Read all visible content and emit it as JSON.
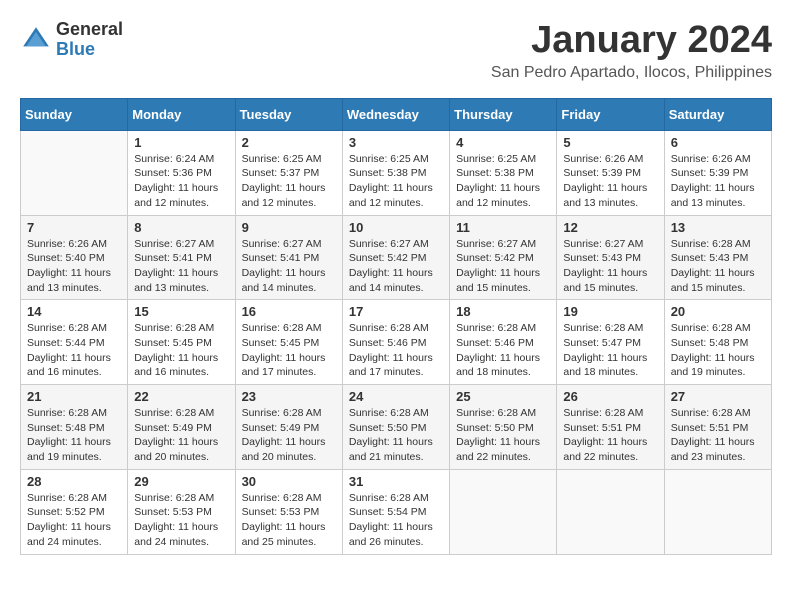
{
  "logo": {
    "general": "General",
    "blue": "Blue"
  },
  "title": "January 2024",
  "subtitle": "San Pedro Apartado, Ilocos, Philippines",
  "days_of_week": [
    "Sunday",
    "Monday",
    "Tuesday",
    "Wednesday",
    "Thursday",
    "Friday",
    "Saturday"
  ],
  "weeks": [
    [
      {
        "day": "",
        "sunrise": "",
        "sunset": "",
        "daylight": ""
      },
      {
        "day": "1",
        "sunrise": "Sunrise: 6:24 AM",
        "sunset": "Sunset: 5:36 PM",
        "daylight": "Daylight: 11 hours and 12 minutes."
      },
      {
        "day": "2",
        "sunrise": "Sunrise: 6:25 AM",
        "sunset": "Sunset: 5:37 PM",
        "daylight": "Daylight: 11 hours and 12 minutes."
      },
      {
        "day": "3",
        "sunrise": "Sunrise: 6:25 AM",
        "sunset": "Sunset: 5:38 PM",
        "daylight": "Daylight: 11 hours and 12 minutes."
      },
      {
        "day": "4",
        "sunrise": "Sunrise: 6:25 AM",
        "sunset": "Sunset: 5:38 PM",
        "daylight": "Daylight: 11 hours and 12 minutes."
      },
      {
        "day": "5",
        "sunrise": "Sunrise: 6:26 AM",
        "sunset": "Sunset: 5:39 PM",
        "daylight": "Daylight: 11 hours and 13 minutes."
      },
      {
        "day": "6",
        "sunrise": "Sunrise: 6:26 AM",
        "sunset": "Sunset: 5:39 PM",
        "daylight": "Daylight: 11 hours and 13 minutes."
      }
    ],
    [
      {
        "day": "7",
        "sunrise": "Sunrise: 6:26 AM",
        "sunset": "Sunset: 5:40 PM",
        "daylight": "Daylight: 11 hours and 13 minutes."
      },
      {
        "day": "8",
        "sunrise": "Sunrise: 6:27 AM",
        "sunset": "Sunset: 5:41 PM",
        "daylight": "Daylight: 11 hours and 13 minutes."
      },
      {
        "day": "9",
        "sunrise": "Sunrise: 6:27 AM",
        "sunset": "Sunset: 5:41 PM",
        "daylight": "Daylight: 11 hours and 14 minutes."
      },
      {
        "day": "10",
        "sunrise": "Sunrise: 6:27 AM",
        "sunset": "Sunset: 5:42 PM",
        "daylight": "Daylight: 11 hours and 14 minutes."
      },
      {
        "day": "11",
        "sunrise": "Sunrise: 6:27 AM",
        "sunset": "Sunset: 5:42 PM",
        "daylight": "Daylight: 11 hours and 15 minutes."
      },
      {
        "day": "12",
        "sunrise": "Sunrise: 6:27 AM",
        "sunset": "Sunset: 5:43 PM",
        "daylight": "Daylight: 11 hours and 15 minutes."
      },
      {
        "day": "13",
        "sunrise": "Sunrise: 6:28 AM",
        "sunset": "Sunset: 5:43 PM",
        "daylight": "Daylight: 11 hours and 15 minutes."
      }
    ],
    [
      {
        "day": "14",
        "sunrise": "Sunrise: 6:28 AM",
        "sunset": "Sunset: 5:44 PM",
        "daylight": "Daylight: 11 hours and 16 minutes."
      },
      {
        "day": "15",
        "sunrise": "Sunrise: 6:28 AM",
        "sunset": "Sunset: 5:45 PM",
        "daylight": "Daylight: 11 hours and 16 minutes."
      },
      {
        "day": "16",
        "sunrise": "Sunrise: 6:28 AM",
        "sunset": "Sunset: 5:45 PM",
        "daylight": "Daylight: 11 hours and 17 minutes."
      },
      {
        "day": "17",
        "sunrise": "Sunrise: 6:28 AM",
        "sunset": "Sunset: 5:46 PM",
        "daylight": "Daylight: 11 hours and 17 minutes."
      },
      {
        "day": "18",
        "sunrise": "Sunrise: 6:28 AM",
        "sunset": "Sunset: 5:46 PM",
        "daylight": "Daylight: 11 hours and 18 minutes."
      },
      {
        "day": "19",
        "sunrise": "Sunrise: 6:28 AM",
        "sunset": "Sunset: 5:47 PM",
        "daylight": "Daylight: 11 hours and 18 minutes."
      },
      {
        "day": "20",
        "sunrise": "Sunrise: 6:28 AM",
        "sunset": "Sunset: 5:48 PM",
        "daylight": "Daylight: 11 hours and 19 minutes."
      }
    ],
    [
      {
        "day": "21",
        "sunrise": "Sunrise: 6:28 AM",
        "sunset": "Sunset: 5:48 PM",
        "daylight": "Daylight: 11 hours and 19 minutes."
      },
      {
        "day": "22",
        "sunrise": "Sunrise: 6:28 AM",
        "sunset": "Sunset: 5:49 PM",
        "daylight": "Daylight: 11 hours and 20 minutes."
      },
      {
        "day": "23",
        "sunrise": "Sunrise: 6:28 AM",
        "sunset": "Sunset: 5:49 PM",
        "daylight": "Daylight: 11 hours and 20 minutes."
      },
      {
        "day": "24",
        "sunrise": "Sunrise: 6:28 AM",
        "sunset": "Sunset: 5:50 PM",
        "daylight": "Daylight: 11 hours and 21 minutes."
      },
      {
        "day": "25",
        "sunrise": "Sunrise: 6:28 AM",
        "sunset": "Sunset: 5:50 PM",
        "daylight": "Daylight: 11 hours and 22 minutes."
      },
      {
        "day": "26",
        "sunrise": "Sunrise: 6:28 AM",
        "sunset": "Sunset: 5:51 PM",
        "daylight": "Daylight: 11 hours and 22 minutes."
      },
      {
        "day": "27",
        "sunrise": "Sunrise: 6:28 AM",
        "sunset": "Sunset: 5:51 PM",
        "daylight": "Daylight: 11 hours and 23 minutes."
      }
    ],
    [
      {
        "day": "28",
        "sunrise": "Sunrise: 6:28 AM",
        "sunset": "Sunset: 5:52 PM",
        "daylight": "Daylight: 11 hours and 24 minutes."
      },
      {
        "day": "29",
        "sunrise": "Sunrise: 6:28 AM",
        "sunset": "Sunset: 5:53 PM",
        "daylight": "Daylight: 11 hours and 24 minutes."
      },
      {
        "day": "30",
        "sunrise": "Sunrise: 6:28 AM",
        "sunset": "Sunset: 5:53 PM",
        "daylight": "Daylight: 11 hours and 25 minutes."
      },
      {
        "day": "31",
        "sunrise": "Sunrise: 6:28 AM",
        "sunset": "Sunset: 5:54 PM",
        "daylight": "Daylight: 11 hours and 26 minutes."
      },
      {
        "day": "",
        "sunrise": "",
        "sunset": "",
        "daylight": ""
      },
      {
        "day": "",
        "sunrise": "",
        "sunset": "",
        "daylight": ""
      },
      {
        "day": "",
        "sunrise": "",
        "sunset": "",
        "daylight": ""
      }
    ]
  ]
}
